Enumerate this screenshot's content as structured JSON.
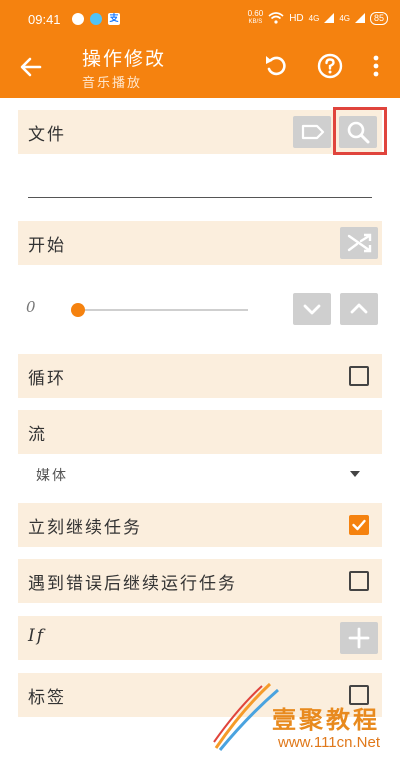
{
  "status_bar": {
    "time": "09:41",
    "speed_value": "0.60",
    "speed_unit": "KB/S",
    "network": "HD",
    "signal1": "4G",
    "signal2": "4G",
    "battery": "85",
    "alipay_icon_char": "支"
  },
  "toolbar": {
    "title": "操作修改",
    "subtitle": "音乐播放"
  },
  "file_row": {
    "label": "文件"
  },
  "start_row": {
    "label": "开始"
  },
  "slider": {
    "value_text": "0",
    "level": 0.0
  },
  "loop_row": {
    "label": "循环",
    "checked": false
  },
  "stream_row": {
    "label": "流",
    "selected": "媒体"
  },
  "continue_row": {
    "label": "立刻继续任务",
    "checked": true
  },
  "error_row": {
    "label": "遇到错误后继续运行任务",
    "checked": false
  },
  "if_row": {
    "label": "If"
  },
  "tag_row": {
    "label": "标签",
    "checked": false
  },
  "watermark": {
    "brand": "壹聚教程",
    "url": "www.111cn.Net"
  },
  "colors": {
    "accent": "#f5820f",
    "row_bg": "#fbeedd",
    "highlight": "#e0443c"
  }
}
